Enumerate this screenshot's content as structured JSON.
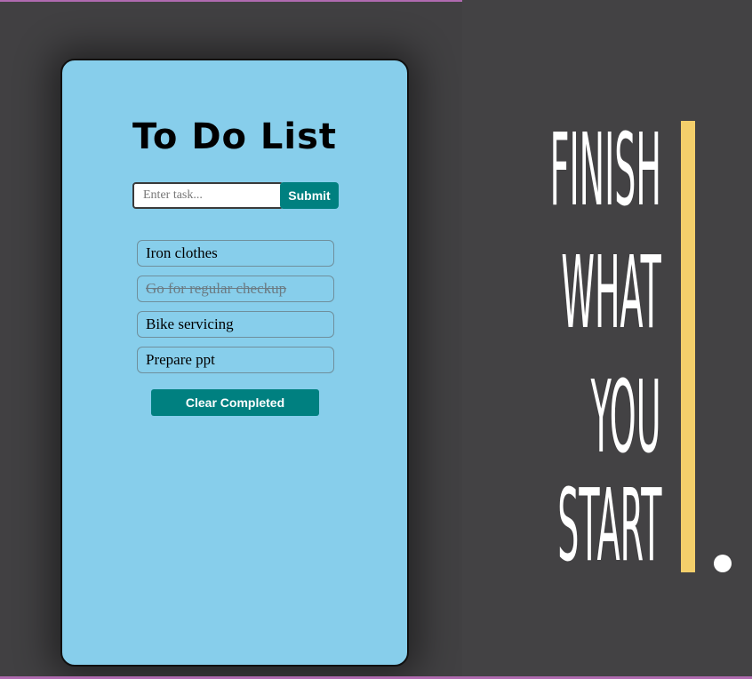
{
  "todo": {
    "title": "To Do List",
    "input": {
      "placeholder": "Enter task...",
      "value": ""
    },
    "submit_label": "Submit",
    "tasks": [
      {
        "label": "Iron clothes",
        "completed": false
      },
      {
        "label": "Go for regular checkup",
        "completed": true
      },
      {
        "label": "Bike servicing",
        "completed": false
      },
      {
        "label": "Prepare ppt",
        "completed": false
      }
    ],
    "clear_label": "Clear Completed"
  },
  "poster": {
    "lines": [
      "FINISH",
      "WHAT",
      "YOU",
      "START"
    ],
    "accent_color": "#f4cf6b"
  },
  "colors": {
    "page_background": "#414042",
    "card_background": "#87ceeb",
    "button_background": "#008080",
    "border_accent": "#b06ab0"
  }
}
